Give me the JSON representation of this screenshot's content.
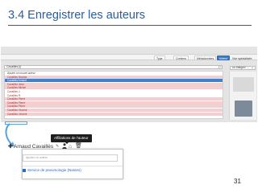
{
  "slide": {
    "title": "3.4 Enregistrer les auteurs",
    "page_number": "31"
  },
  "toolbar": {
    "buttons": [
      {
        "label": "Type",
        "icon": "document-icon"
      },
      {
        "label": "Contenu",
        "icon": "document-icon"
      },
      {
        "label": "Métadonnées",
        "icon": "document-icon"
      },
      {
        "label": "Auteur",
        "icon": "user-icon"
      },
      {
        "label": "Vue spécialisée",
        "icon": "eye-icon"
      }
    ]
  },
  "author_search": {
    "value": "Cavailles (l)"
  },
  "integrate_dropdown": {
    "value": "ou intégrer ..."
  },
  "author_options": [
    {
      "label": "Ajouter un nouvel auteur",
      "style": "header"
    },
    {
      "label": "Cavailles Nicolas",
      "style": "pink"
    },
    {
      "label": "Cavailles Arnaud",
      "style": "blue"
    },
    {
      "label": "Cavailles Jean",
      "style": "pink"
    },
    {
      "label": "Cavailles Michel",
      "style": "pink"
    },
    {
      "label": "Cavailles J.",
      "style": "white"
    },
    {
      "label": "Cavailles R.",
      "style": "white"
    },
    {
      "label": "Cavailles Pierre",
      "style": "pink"
    },
    {
      "label": "Cavailles Pierre",
      "style": "pink"
    },
    {
      "label": "Cavailles Pierre",
      "style": "pink"
    },
    {
      "label": "Cavailles Vincent",
      "style": "pink"
    },
    {
      "label": "Cavailles Vincent",
      "style": "pink"
    }
  ],
  "inset": {
    "tooltip": "Affiliations de l'auteur",
    "author_name": "Arnaud Cavaillès",
    "affiliation_placeholder": "Ajouter un auteur",
    "affiliation_label": "Service de pneumologie (Nantes)"
  },
  "colors": {
    "title": "#2a5d9f",
    "selected_row": "#3b82d1",
    "unmatched_row": "#f4cfd1",
    "active_button": "#3a7dc8",
    "affiliation": "#2b6bb8"
  }
}
